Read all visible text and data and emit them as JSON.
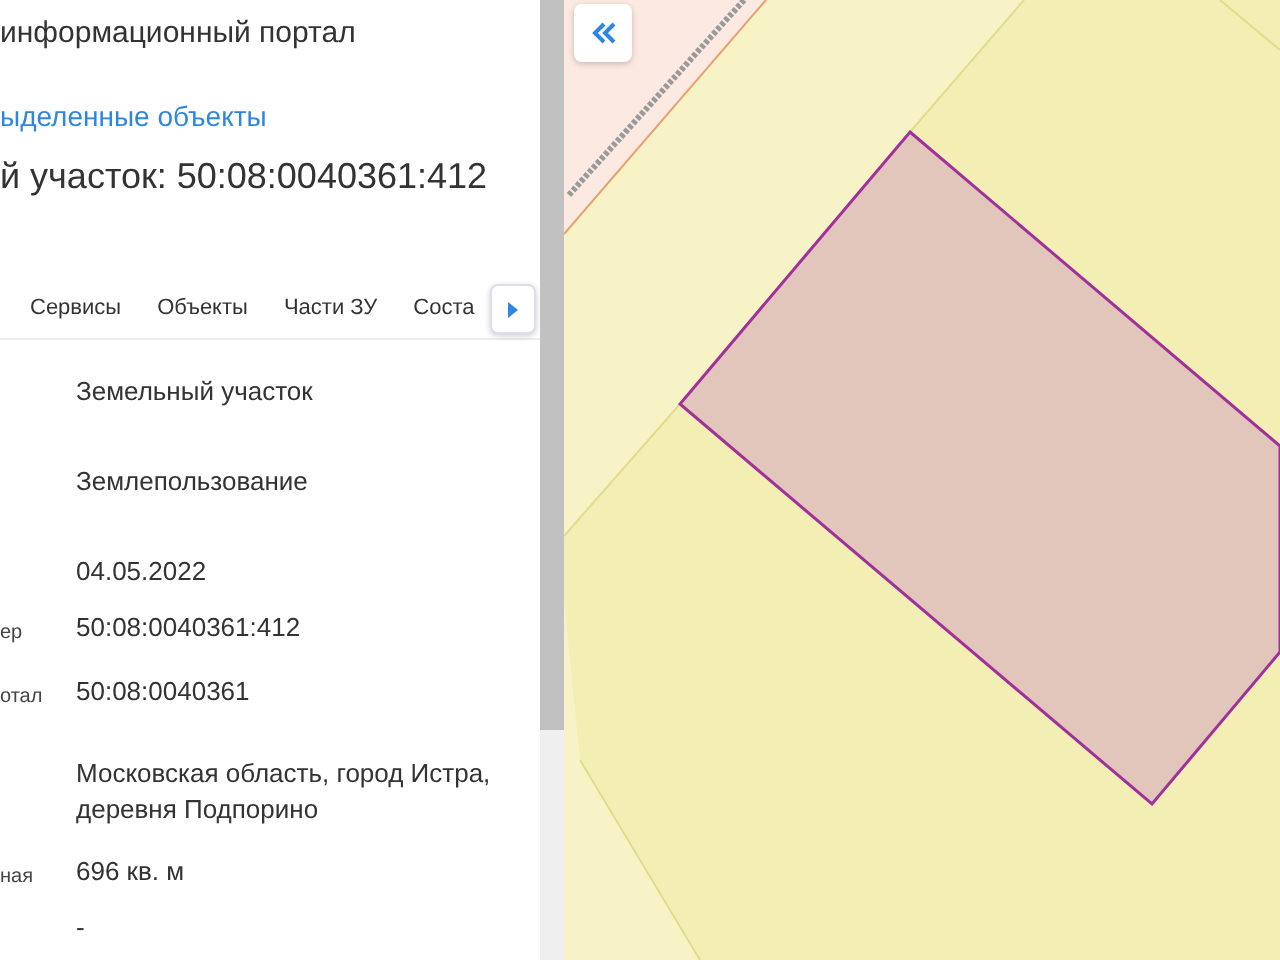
{
  "header": {
    "title": "информационный портал"
  },
  "selected_objects_link": "ыделенные объекты",
  "object_title": "й участок: 50:08:0040361:412",
  "tabs": [
    {
      "label": "Сервисы",
      "selected": false
    },
    {
      "label": "Объекты",
      "selected": false
    },
    {
      "label": "Части ЗУ",
      "selected": false
    },
    {
      "label": "Соста",
      "selected": false
    }
  ],
  "attributes": [
    {
      "value": "Земельный участок"
    },
    {
      "value": "Землепользование"
    },
    {
      "value": "04.05.2022"
    },
    {
      "label": "ер",
      "value": "50:08:0040361:412"
    },
    {
      "label": "отал",
      "value": "50:08:0040361"
    },
    {
      "value": "Московская область, город Истра, деревня Подпорино"
    },
    {
      "label": "ная",
      "value": "696 кв. м"
    },
    {
      "value": "-"
    }
  ]
}
